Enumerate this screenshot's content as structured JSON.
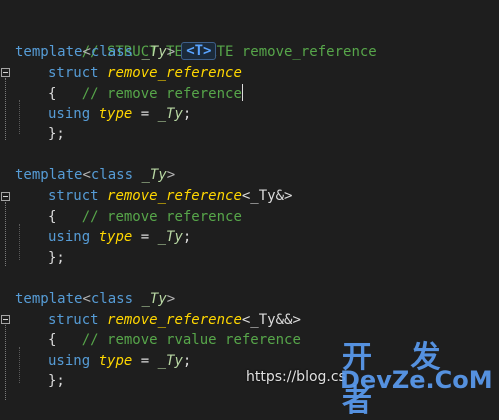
{
  "code": {
    "line1": {
      "comment": "// STRUCT TEMPLATE remove_reference"
    },
    "block1": {
      "template_kw": "template",
      "lt": "<",
      "class_kw": "class",
      "param": " _Ty",
      "gt": ">",
      "hint": "<T>",
      "struct_kw": "struct",
      "name": "remove_reference",
      "specialization": "",
      "open_brace": "{",
      "comment": "// remove reference",
      "using_kw": "using",
      "type_name": "type",
      "eq": " = ",
      "ty": "_Ty",
      "semi": ";",
      "close": "};"
    },
    "block2": {
      "template_kw": "template",
      "lt": "<",
      "class_kw": "class",
      "param": " _Ty",
      "gt": ">",
      "struct_kw": "struct",
      "name": "remove_reference",
      "specialization": "<_Ty&>",
      "open_brace": "{",
      "comment": "// remove reference",
      "using_kw": "using",
      "type_name": "type",
      "eq": " = ",
      "ty": "_Ty",
      "semi": ";",
      "close": "};"
    },
    "block3": {
      "template_kw": "template",
      "lt": "<",
      "class_kw": "class",
      "param": " _Ty",
      "gt": ">",
      "struct_kw": "struct",
      "name": "remove_reference",
      "specialization": "<_Ty&&>",
      "open_brace": "{",
      "comment": "// remove rvalue reference",
      "using_kw": "using",
      "type_name": "type",
      "eq": " = ",
      "ty": "_Ty",
      "semi": ";",
      "close": "};"
    }
  },
  "watermark": {
    "url": "https://blog.cs",
    "brand_cn": "开 发 者",
    "brand_en": "DevZe.CoM"
  },
  "colors": {
    "background": "#1e1e1e",
    "keyword": "#569cd6",
    "comment": "#57a64a",
    "type_name": "#ffd700",
    "template_param": "#b8d7a3",
    "watermark": "#5a9bf0"
  }
}
